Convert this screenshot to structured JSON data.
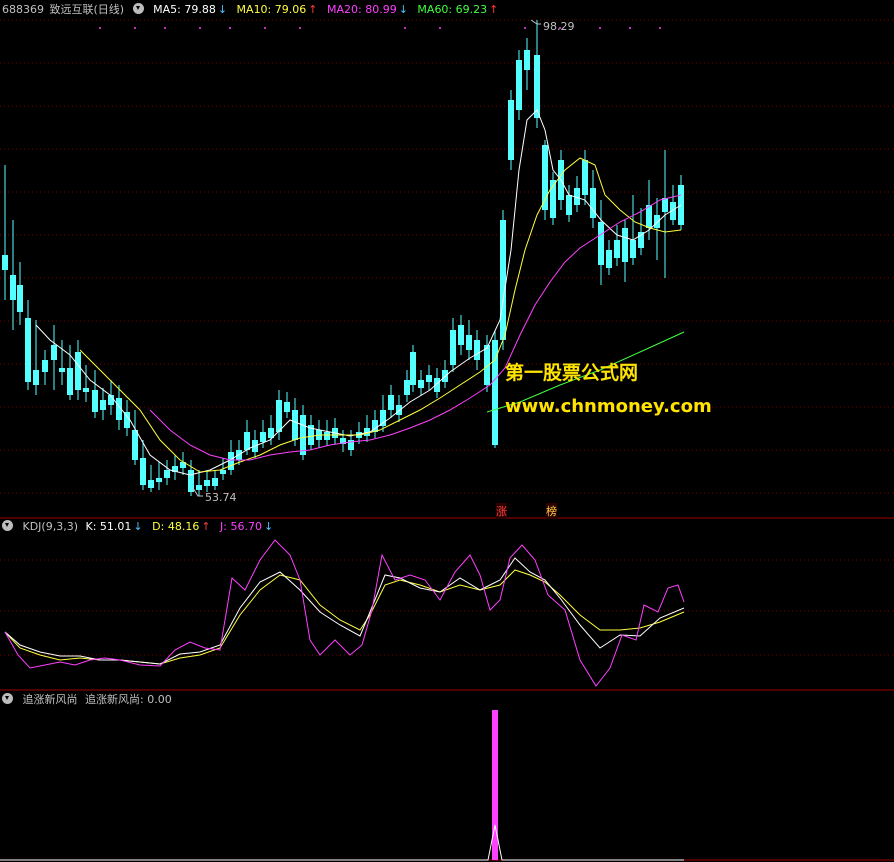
{
  "main": {
    "stock_code": "688369",
    "stock_name": "致远互联",
    "period": "(日线)",
    "ma": [
      {
        "label": "MA5:",
        "value": "79.88",
        "arrow": "↓",
        "color": "#ffffff"
      },
      {
        "label": "MA10:",
        "value": "79.06",
        "arrow": "↑",
        "color": "#ffff40"
      },
      {
        "label": "MA20:",
        "value": "80.99",
        "arrow": "↓",
        "color": "#ff40ff"
      },
      {
        "label": "MA60:",
        "value": "69.23",
        "arrow": "↑",
        "color": "#40ff40"
      }
    ],
    "high_label": "98.29",
    "low_label": "53.74",
    "tag_zhang": "涨",
    "tag_bang": "榜",
    "watermark_cn": "第一股票公式网",
    "watermark_url": "www.chnmoney.com"
  },
  "kdj": {
    "name": "KDJ(9,3,3)",
    "k_label": "K:",
    "k_value": "51.01",
    "k_arrow": "↓",
    "d_label": "D:",
    "d_value": "48.16",
    "d_arrow": "↑",
    "j_label": "J:",
    "j_value": "56.70",
    "j_arrow": "↓"
  },
  "custom": {
    "name": "追涨新风尚",
    "series_label": "追涨新风尚:",
    "series_value": "0.00"
  },
  "colors": {
    "up": "#ff3232",
    "down": "#54ffff",
    "ma5": "#ffffff",
    "ma10": "#ffff40",
    "ma20": "#ff40ff",
    "ma60": "#40ff40",
    "k": "#ffffff",
    "d": "#ffff40",
    "j": "#ff40ff",
    "signal": "#ff40ff",
    "panel_border": "#a00000",
    "grid": "#800000"
  }
}
